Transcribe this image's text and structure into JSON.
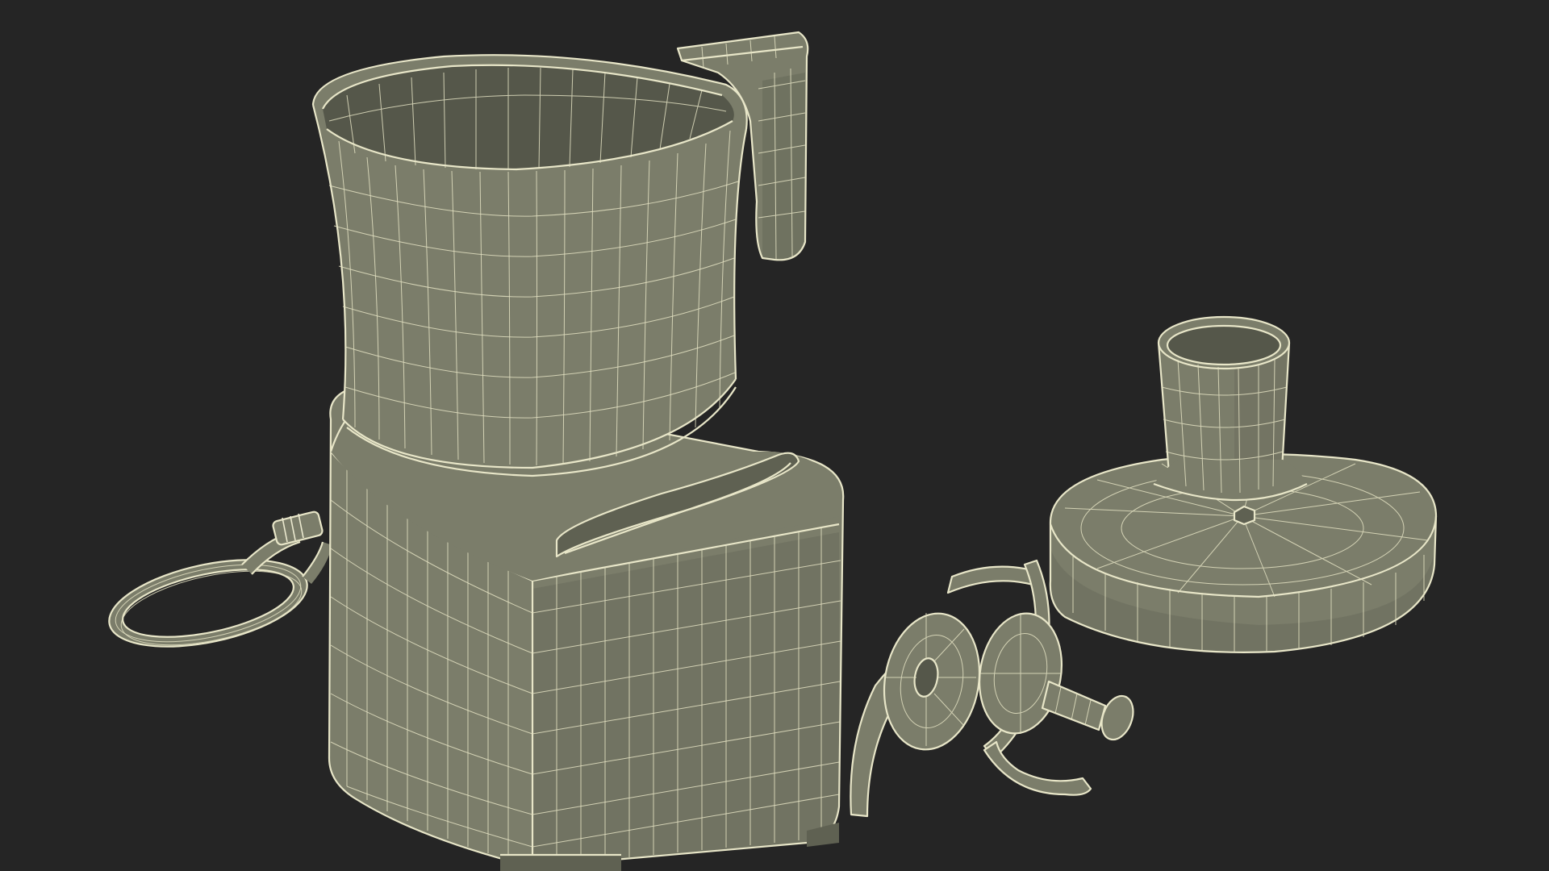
{
  "colors": {
    "background": "#252525",
    "mesh_surface": "#7b7d6a",
    "mesh_surface_shadow": "#5f6152",
    "wireframe_lines": "#e8e6c8"
  },
  "objects": [
    {
      "id": "food-processor-bowl",
      "name": "bowl-with-handle"
    },
    {
      "id": "motor-base",
      "name": "motor-base"
    },
    {
      "id": "power-cord",
      "name": "coiled-power-cord"
    },
    {
      "id": "chopping-blade",
      "name": "s-blade-attachment"
    },
    {
      "id": "bowl-lid",
      "name": "lid-with-feed-tube"
    }
  ]
}
